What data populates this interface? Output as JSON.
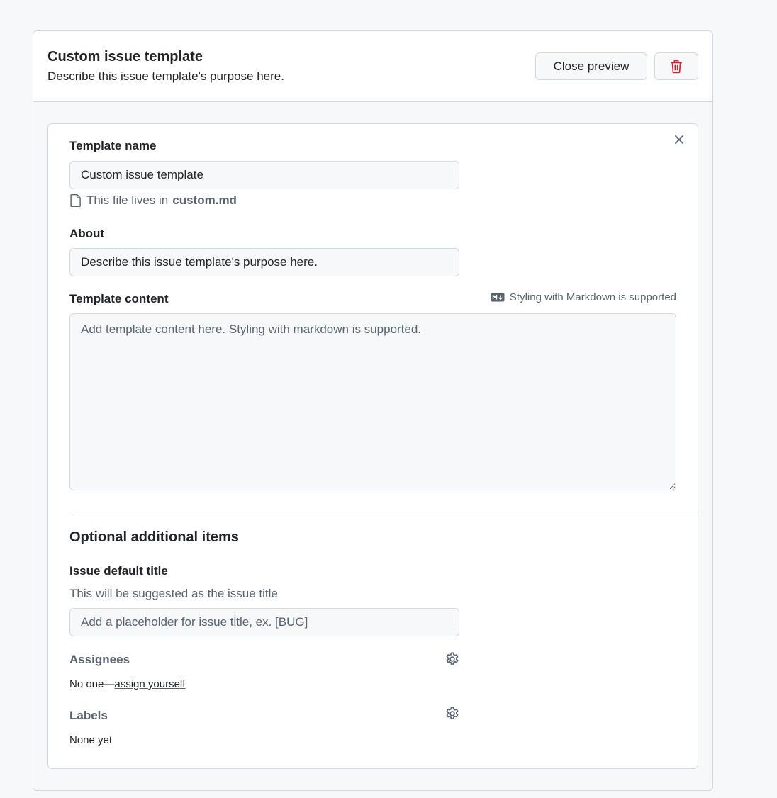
{
  "header": {
    "title": "Custom issue template",
    "description": "Describe this issue template's purpose here.",
    "close_preview_label": "Close preview"
  },
  "form": {
    "template_name_label": "Template name",
    "template_name_value": "Custom issue template",
    "file_note_prefix": "This file lives in",
    "file_name": "custom.md",
    "about_label": "About",
    "about_value": "Describe this issue template's purpose here.",
    "content_label": "Template content",
    "markdown_note": "Styling with Markdown is supported",
    "content_placeholder": "Add template content here. Styling with markdown is supported."
  },
  "optional": {
    "section_title": "Optional additional items",
    "default_title_label": "Issue default title",
    "default_title_desc": "This will be suggested as the issue title",
    "default_title_placeholder": "Add a placeholder for issue title, ex. [BUG]",
    "assignees_label": "Assignees",
    "assignees_prefix": "No one—",
    "assign_yourself": "assign yourself",
    "labels_label": "Labels",
    "labels_value": "None yet"
  },
  "colors": {
    "danger": "#d1242f",
    "muted": "#59636e",
    "border": "#d1d9e0"
  },
  "icons": {
    "delete": "trash-icon",
    "close": "close-icon",
    "file": "file-icon",
    "markdown": "markdown-icon",
    "settings": "gear-icon"
  }
}
